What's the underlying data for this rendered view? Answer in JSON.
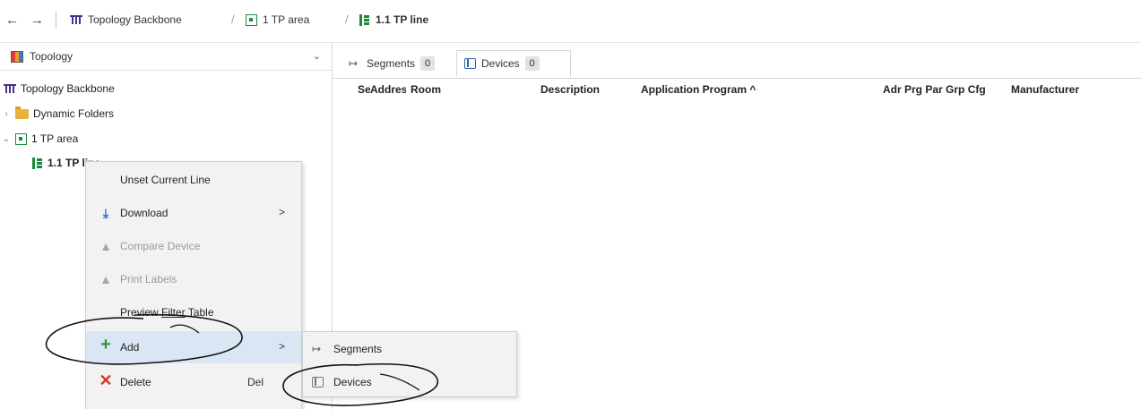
{
  "breadcrumb": {
    "back_glyph": "←",
    "forward_glyph": "→",
    "separator": "/",
    "items": [
      {
        "label": "Topology Backbone",
        "icon": "backbone-icon"
      },
      {
        "label": "1 TP area",
        "icon": "area-icon"
      },
      {
        "label": "1.1 TP line",
        "icon": "line-icon"
      }
    ]
  },
  "left_panel": {
    "title": "Topology",
    "tree": [
      {
        "label": "Topology Backbone"
      },
      {
        "label": "Dynamic Folders"
      },
      {
        "label": "1 TP area"
      },
      {
        "label": "1.1 TP line"
      }
    ]
  },
  "tabs": [
    {
      "label": "Segments",
      "count": "0"
    },
    {
      "label": "Devices",
      "count": "0"
    }
  ],
  "table": {
    "columns": [
      "Se",
      "Addres",
      "Room",
      "Description",
      "Application Program ^",
      "Adr Prg Par Grp Cfg",
      "Manufacturer"
    ]
  },
  "context_menu": {
    "items": [
      {
        "label": "Unset Current Line",
        "enabled": true
      },
      {
        "label": "Download",
        "enabled": true,
        "has_submenu": true,
        "icon": "download-icon"
      },
      {
        "label": "Compare Device",
        "enabled": false,
        "icon": "lock-icon"
      },
      {
        "label": "Print Labels",
        "enabled": false,
        "icon": "lock-icon"
      },
      {
        "label": "Preview Filter Table",
        "enabled": true
      },
      {
        "label": "Add",
        "enabled": true,
        "has_submenu": true,
        "highlighted": true,
        "icon": "plus-icon"
      },
      {
        "label": "Delete",
        "enabled": true,
        "shortcut": "Del",
        "icon": "delete-icon"
      }
    ],
    "submenu_arrow": ">"
  },
  "add_submenu": {
    "items": [
      {
        "label": "Segments",
        "icon": "segment-icon"
      },
      {
        "label": "Devices",
        "icon": "device-icon"
      }
    ]
  },
  "colors": {
    "menu_highlight": "#dbe6f5",
    "menu_background": "#f2f2f2",
    "area_green": "#1b8a3a",
    "backbone_purple": "#4a2f8a"
  }
}
